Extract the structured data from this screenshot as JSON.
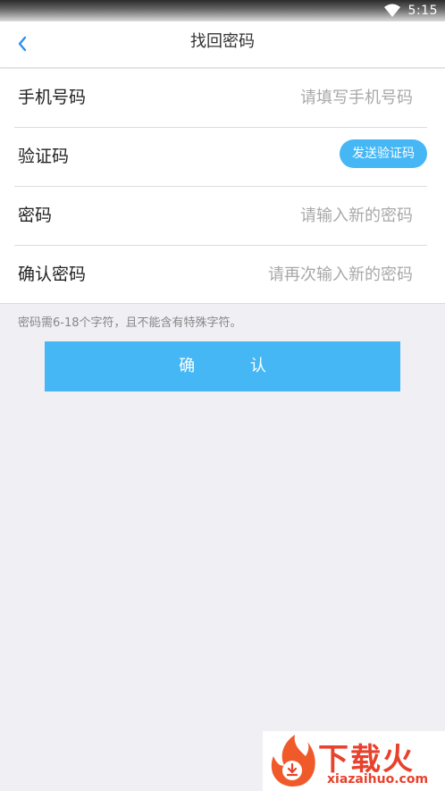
{
  "status_bar": {
    "time": "5:15",
    "wifi_icon": "wifi-icon"
  },
  "nav": {
    "back_icon": "chevron-left-icon",
    "title": "找回密码"
  },
  "form": {
    "phone": {
      "label": "手机号码",
      "placeholder": "请填写手机号码"
    },
    "code": {
      "label": "验证码",
      "button": "发送验证码"
    },
    "password": {
      "label": "密码",
      "placeholder": "请输入新的密码"
    },
    "confirm_password": {
      "label": "确认密码",
      "placeholder": "请再次输入新的密码"
    }
  },
  "hint": "密码需6-18个字符，且不能含有特殊字符。",
  "confirm_button": "确 认",
  "watermark": {
    "brand": "下载火",
    "domain": "xiazaihuo.com"
  },
  "colors": {
    "accent": "#45b7f5",
    "background": "#efeff4",
    "watermark": "#e8412c"
  }
}
